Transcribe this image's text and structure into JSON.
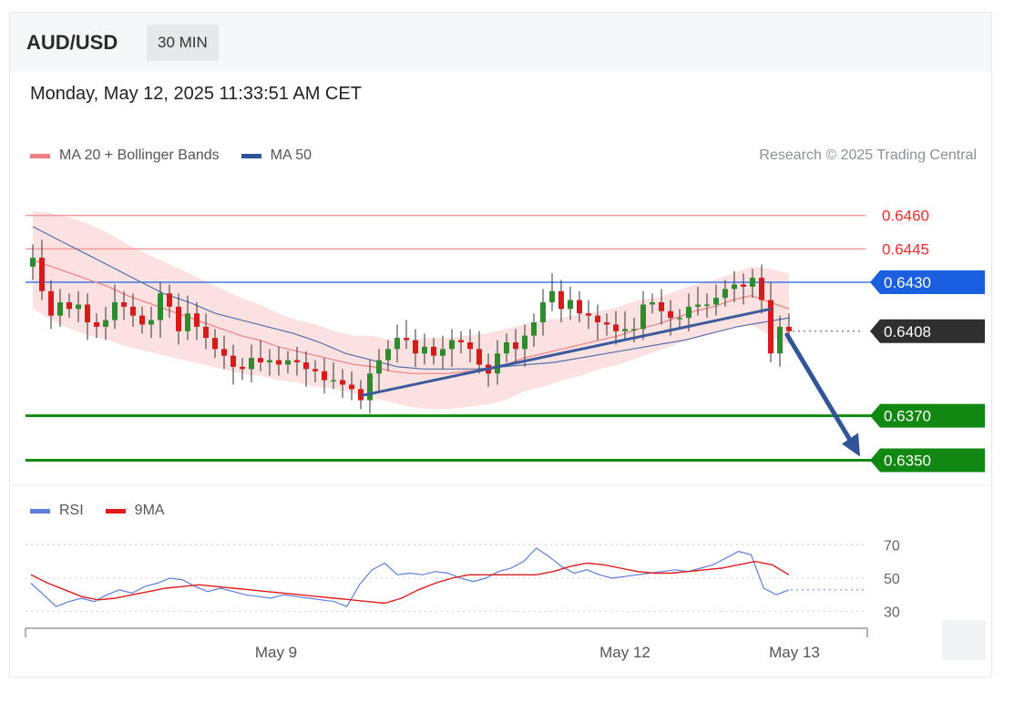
{
  "header": {
    "symbol": "AUD/USD",
    "timeframe": "30 MIN"
  },
  "datetime": "Monday, May 12, 2025 11:33:51 AM CET",
  "legend": [
    {
      "label": "MA 20 + Bollinger Bands",
      "color": "#f08080"
    },
    {
      "label": "MA 50",
      "color": "#2f5597"
    }
  ],
  "credit": "Research © 2025 Trading Central",
  "rsi_legend": [
    {
      "label": "RSI",
      "color": "#5b7fdc"
    },
    {
      "label": "9MA",
      "color": "#e31a1c"
    }
  ],
  "chart_data": [
    {
      "type": "candlestick",
      "title": "",
      "ylim": [
        0.634,
        0.6475
      ],
      "x_ticks": [
        "May 9",
        "May 12",
        "May 13"
      ],
      "levels": [
        {
          "value": 0.646,
          "label": "0.6460",
          "kind": "resistance",
          "color": "#ff2b2b"
        },
        {
          "value": 0.6445,
          "label": "0.6445",
          "kind": "resistance",
          "color": "#ff2b2b"
        },
        {
          "value": 0.643,
          "label": "0.6430",
          "kind": "pivot",
          "color": "#1a5fe0"
        },
        {
          "value": 0.6408,
          "label": "0.6408",
          "kind": "last-price",
          "color": "#2f2f2f"
        },
        {
          "value": 0.637,
          "label": "0.6370",
          "kind": "support",
          "color": "#118811"
        },
        {
          "value": 0.635,
          "label": "0.6350",
          "kind": "support",
          "color": "#118811"
        }
      ],
      "candles_close": [
        0.6441,
        0.6426,
        0.6415,
        0.6421,
        0.6418,
        0.642,
        0.6412,
        0.641,
        0.6413,
        0.6421,
        0.6419,
        0.6415,
        0.6411,
        0.6413,
        0.6425,
        0.6419,
        0.6408,
        0.6416,
        0.641,
        0.6405,
        0.64,
        0.6397,
        0.6392,
        0.6391,
        0.6396,
        0.6394,
        0.6395,
        0.6393,
        0.6395,
        0.6394,
        0.6391,
        0.639,
        0.6386,
        0.6386,
        0.6384,
        0.6382,
        0.6377,
        0.6389,
        0.6395,
        0.64,
        0.6405,
        0.6404,
        0.6398,
        0.6401,
        0.6397,
        0.64,
        0.6404,
        0.6403,
        0.64,
        0.6393,
        0.6389,
        0.6398,
        0.6403,
        0.64,
        0.6406,
        0.6412,
        0.6421,
        0.6426,
        0.6418,
        0.6422,
        0.6416,
        0.6415,
        0.6412,
        0.6411,
        0.6408,
        0.6409,
        0.6409,
        0.642,
        0.6421,
        0.6417,
        0.6414,
        0.6414,
        0.6419,
        0.642,
        0.642,
        0.6423,
        0.6427,
        0.6429,
        0.6428,
        0.6432,
        0.6422,
        0.6398,
        0.641,
        0.6408
      ],
      "ma20": [
        0.644,
        0.6437,
        0.6434,
        0.6431,
        0.6428,
        0.6424,
        0.6421,
        0.6418,
        0.6415,
        0.6412,
        0.6409,
        0.6406,
        0.6404,
        0.6401,
        0.6399,
        0.6397,
        0.6395,
        0.6393,
        0.6392,
        0.639,
        0.6389,
        0.6389,
        0.6389,
        0.639,
        0.6391,
        0.6393,
        0.6396,
        0.6398,
        0.64,
        0.6402,
        0.6404,
        0.6406,
        0.6409,
        0.6411,
        0.6414,
        0.6417,
        0.6419,
        0.6422,
        0.6424,
        0.6421,
        0.6418
      ],
      "ma50": [
        0.6455,
        0.6449,
        0.6443,
        0.6437,
        0.6431,
        0.6425,
        0.6421,
        0.6416,
        0.6413,
        0.641,
        0.6407,
        0.6403,
        0.6398,
        0.6395,
        0.6392,
        0.6391,
        0.6391,
        0.6391,
        0.6392,
        0.6393,
        0.6394,
        0.6396,
        0.6398,
        0.64,
        0.6402,
        0.6404,
        0.6407,
        0.641,
        0.6412,
        0.6414
      ],
      "trendline": {
        "from": 0.6379,
        "to": 0.6418
      },
      "forecast_target": 0.635
    },
    {
      "type": "line",
      "title": "",
      "ylim": [
        20,
        80
      ],
      "y_ticks": [
        70,
        50,
        30
      ],
      "series": [
        {
          "name": "RSI",
          "values": [
            47,
            40,
            33,
            36,
            38,
            36,
            40,
            43,
            41,
            45,
            47,
            50,
            49,
            45,
            42,
            44,
            42,
            40,
            39,
            38,
            40,
            39,
            38,
            37,
            36,
            33,
            46,
            55,
            59,
            52,
            53,
            52,
            54,
            53,
            50,
            48,
            50,
            54,
            56,
            60,
            68,
            63,
            57,
            53,
            55,
            52,
            50,
            51,
            52,
            53,
            54,
            55,
            54,
            56,
            58,
            62,
            66,
            64,
            44,
            40,
            43
          ]
        },
        {
          "name": "9MA",
          "values": [
            52,
            47,
            43,
            39,
            37,
            38,
            40,
            42,
            44,
            45,
            46,
            45,
            44,
            43,
            42,
            41,
            40,
            39,
            38,
            37,
            36,
            35,
            38,
            43,
            47,
            50,
            52,
            52,
            52,
            52,
            52,
            54,
            57,
            59,
            58,
            56,
            54,
            53,
            53,
            54,
            55,
            56,
            58,
            60,
            58,
            52
          ]
        }
      ],
      "levels": [
        70,
        50,
        30
      ],
      "last_value_level": 43
    }
  ]
}
